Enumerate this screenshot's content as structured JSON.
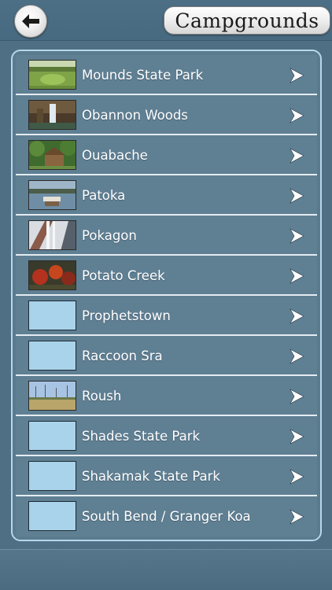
{
  "header": {
    "title": "Campgrounds",
    "back_icon": "back-arrow-icon"
  },
  "colors": {
    "background": "#4f6f84",
    "row": "#5f7f93",
    "divider": "#e4edf2",
    "frame_border": "#b4d9ea",
    "placeholder_thumb": "#a9d3ea"
  },
  "list": {
    "items": [
      {
        "label": "Mounds State Park",
        "thumb": "photo-lawn"
      },
      {
        "label": "Obannon Woods",
        "thumb": "photo-waterfall"
      },
      {
        "label": "Ouabache",
        "thumb": "photo-cabin"
      },
      {
        "label": "Patoka",
        "thumb": "photo-lake"
      },
      {
        "label": "Pokagon",
        "thumb": "photo-toboggan"
      },
      {
        "label": "Potato Creek",
        "thumb": "photo-autumn"
      },
      {
        "label": "Prophetstown",
        "thumb": "placeholder"
      },
      {
        "label": "Raccoon Sra",
        "thumb": "placeholder"
      },
      {
        "label": "Roush",
        "thumb": "photo-field"
      },
      {
        "label": "Shades State Park",
        "thumb": "placeholder"
      },
      {
        "label": "Shakamak State Park",
        "thumb": "placeholder"
      },
      {
        "label": "South Bend / Granger Koa",
        "thumb": "placeholder"
      }
    ],
    "row_icon": "chevron-right-icon"
  }
}
